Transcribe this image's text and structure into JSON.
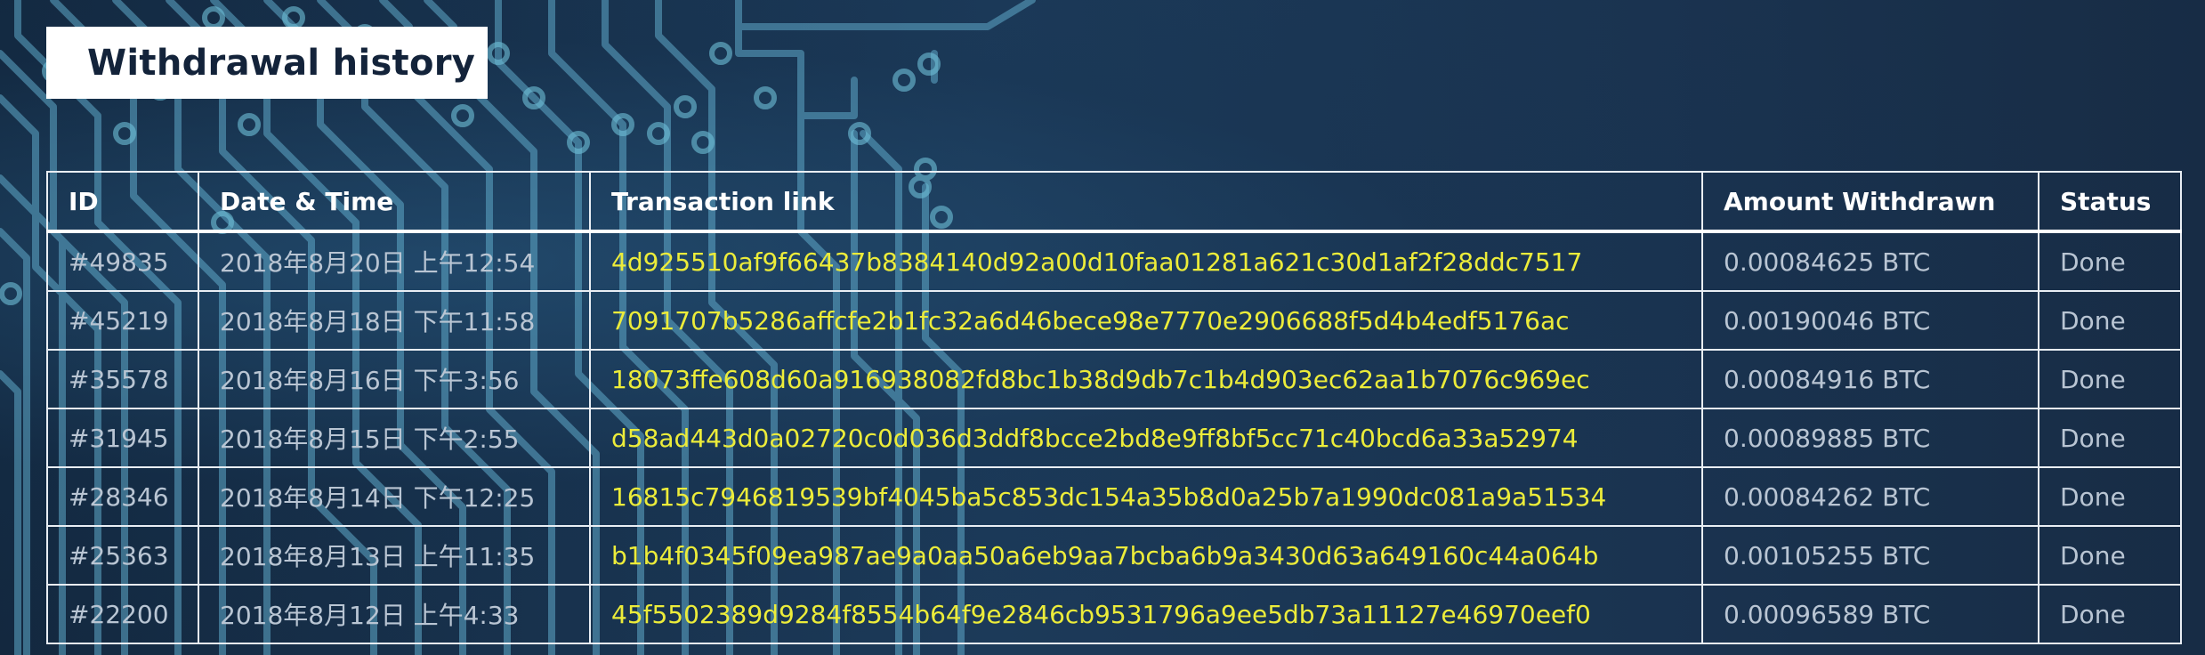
{
  "page": {
    "title": "Withdrawal history"
  },
  "table": {
    "headers": {
      "id": "ID",
      "datetime": "Date & Time",
      "link": "Transaction link",
      "amount": "Amount Withdrawn",
      "status": "Status"
    },
    "rows": [
      {
        "id": "#49835",
        "datetime": "2018年8月20日 上午12:54",
        "link": "4d925510af9f66437b8384140d92a00d10faa01281a621c30d1af2f28ddc7517",
        "amount": "0.00084625 BTC",
        "status": "Done"
      },
      {
        "id": "#45219",
        "datetime": "2018年8月18日 下午11:58",
        "link": "7091707b5286affcfe2b1fc32a6d46bece98e7770e2906688f5d4b4edf5176ac",
        "amount": "0.00190046 BTC",
        "status": "Done"
      },
      {
        "id": "#35578",
        "datetime": "2018年8月16日 下午3:56",
        "link": "18073ffe608d60a916938082fd8bc1b38d9db7c1b4d903ec62aa1b7076c969ec",
        "amount": "0.00084916 BTC",
        "status": "Done"
      },
      {
        "id": "#31945",
        "datetime": "2018年8月15日 下午2:55",
        "link": "d58ad443d0a02720c0d036d3ddf8bcce2bd8e9ff8bf5cc71c40bcd6a33a52974",
        "amount": "0.00089885 BTC",
        "status": "Done"
      },
      {
        "id": "#28346",
        "datetime": "2018年8月14日 下午12:25",
        "link": "16815c7946819539bf4045ba5c853dc154a35b8d0a25b7a1990dc081a9a51534",
        "amount": "0.00084262 BTC",
        "status": "Done"
      },
      {
        "id": "#25363",
        "datetime": "2018年8月13日 上午11:35",
        "link": "b1b4f0345f09ea987ae9a0aa50a6eb9aa7bcba6b9a3430d63a649160c44a064b",
        "amount": "0.00105255 BTC",
        "status": "Done"
      },
      {
        "id": "#22200",
        "datetime": "2018年8月12日 上午4:33",
        "link": "45f5502389d9284f8554b64f9e2846cb9531796a9ee5db73a11127e46970eef0",
        "amount": "0.00096589 BTC",
        "status": "Done"
      }
    ]
  },
  "colors": {
    "background": "#162b44",
    "link": "#ecec3a",
    "cell_text": "#b9c5d3",
    "header_text": "#ffffff",
    "circuit": "#5fa9c9"
  },
  "icons": {
    "background_art": "circuit-board-pattern"
  }
}
